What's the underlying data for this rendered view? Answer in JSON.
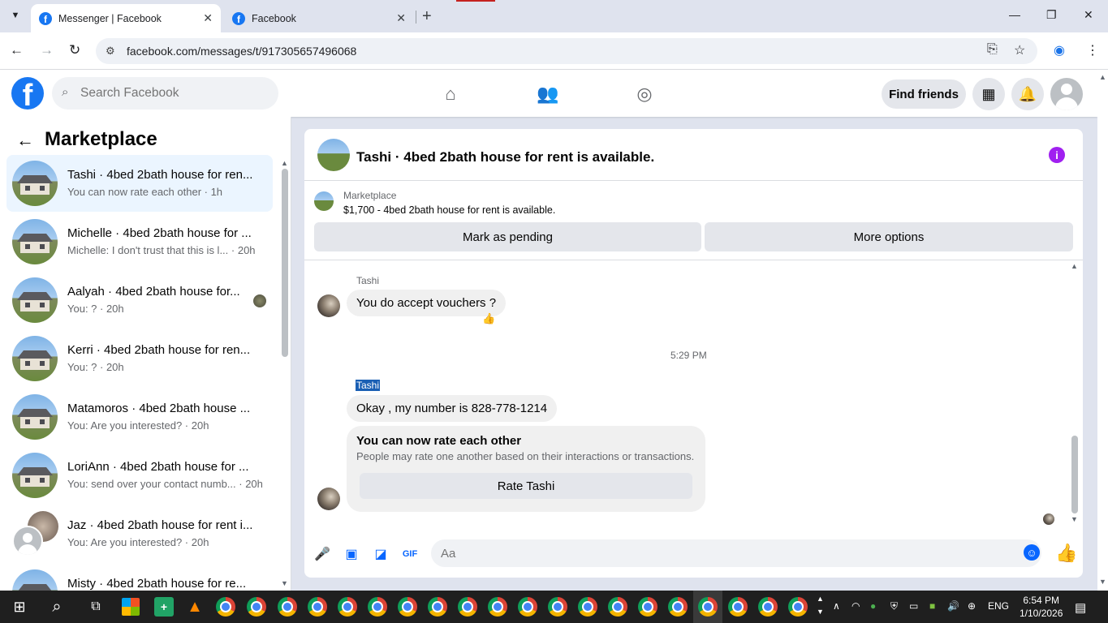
{
  "browser": {
    "tabs": [
      {
        "title": "Messenger | Facebook",
        "active": true
      },
      {
        "title": "Facebook",
        "active": false
      }
    ],
    "url": "facebook.com/messages/t/917305657496068"
  },
  "header": {
    "search_placeholder": "Search Facebook",
    "find_friends": "Find friends"
  },
  "sidebar": {
    "title": "Marketplace",
    "conversations": [
      {
        "name": "Tashi · 4bed 2bath house for ren...",
        "snippet": "You can now rate each other · 1h",
        "active": true
      },
      {
        "name": "Michelle · 4bed 2bath house for ...",
        "snippet": "Michelle: I don't trust that this is l...  · 20h"
      },
      {
        "name": "Aalyah · 4bed 2bath house for...",
        "snippet": "You: ? · 20h"
      },
      {
        "name": "Kerri · 4bed 2bath house for ren...",
        "snippet": "You: ? · 20h"
      },
      {
        "name": "Matamoros · 4bed 2bath house ...",
        "snippet": "You: Are you interested? · 20h"
      },
      {
        "name": "LoriAnn · 4bed 2bath house for ...",
        "snippet": "You: send over your contact numb... · 20h"
      },
      {
        "name": "Jaz · 4bed 2bath house for rent i...",
        "snippet": "You: Are you interested? · 20h"
      },
      {
        "name": "Misty · 4bed 2bath house for re...",
        "snippet": ""
      }
    ]
  },
  "chat": {
    "title": "Tashi · 4bed 2bath house for rent is available.",
    "marketplace_label": "Marketplace",
    "listing": "$1,700 - 4bed 2bath house for rent is available.",
    "mark_pending": "Mark as pending",
    "more_options": "More options",
    "messages": [
      {
        "sender": "Tashi",
        "text": "You do accept vouchers ?"
      },
      {
        "sender": "Tashi",
        "text": "Okay , my number is 828-778-1214"
      }
    ],
    "timestamp": "5:29 PM",
    "rate_card": {
      "heading": "You can now rate each other",
      "body": "People may rate one another based on their interactions or transactions.",
      "button": "Rate Tashi"
    },
    "composer_placeholder": "Aa"
  },
  "taskbar": {
    "lang": "ENG",
    "time": "6:54 PM",
    "date": "1/10/2026"
  }
}
